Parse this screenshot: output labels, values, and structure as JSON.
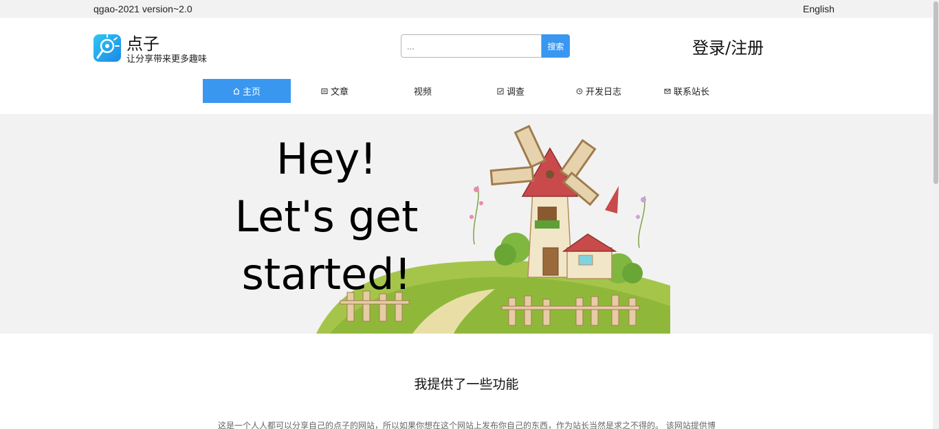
{
  "topbar": {
    "version": "qgao-2021 version~2.0",
    "language": "English"
  },
  "brand": {
    "title": "点子",
    "subtitle": "让分享带来更多趣味",
    "icon": "lightbulb-icon"
  },
  "search": {
    "placeholder": "...",
    "value": "",
    "button_label": "搜索"
  },
  "auth": {
    "label": "登录/注册"
  },
  "nav": {
    "items": [
      {
        "label": "主页",
        "icon": "home-icon",
        "active": true
      },
      {
        "label": "文章",
        "icon": "article-icon",
        "active": false
      },
      {
        "label": "视频",
        "icon": "",
        "active": false
      },
      {
        "label": "调查",
        "icon": "survey-icon",
        "active": false
      },
      {
        "label": "开发日志",
        "icon": "history-icon",
        "active": false
      },
      {
        "label": "联系站长",
        "icon": "mail-icon",
        "active": false
      }
    ]
  },
  "hero": {
    "line1": "Hey!",
    "line2": "Let's get",
    "line3": "started!"
  },
  "features": {
    "title": "我提供了一些功能",
    "intro": "这是一个人人都可以分享自己的点子的网站，所以如果你想在这个网站上发布你自己的东西，作为站长当然是求之不得的。 该网站提供博"
  },
  "colors": {
    "accent": "#3a97f0",
    "hero_bg": "#f2f2f2",
    "topbar_bg": "#f2f2f2"
  }
}
